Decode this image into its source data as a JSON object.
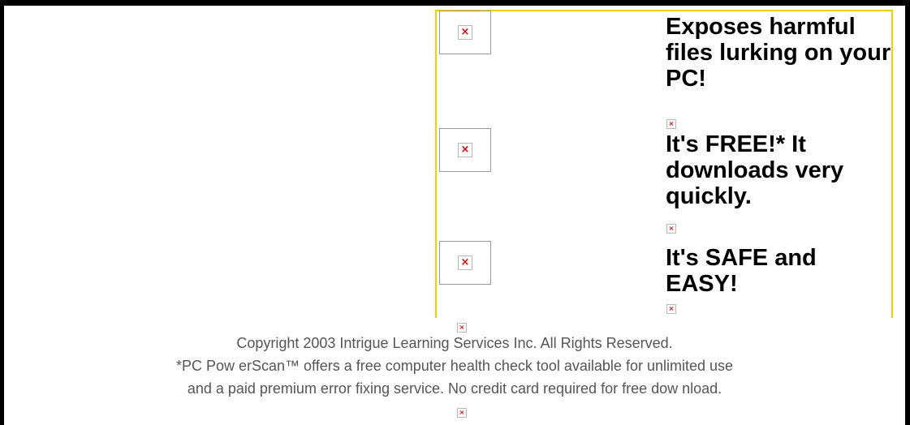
{
  "features": [
    {
      "text": "Exposes harmful files lurking on your PC!",
      "icon": "broken-image-icon"
    },
    {
      "text": "It's FREE!* It downloads very quickly.",
      "icon": "broken-image-icon"
    },
    {
      "text": "It's SAFE and EASY!",
      "icon": "broken-image-icon"
    }
  ],
  "footer": {
    "copyright": "Copyright 2003 Intrigue Learning Services Inc. All Rights Reserved.",
    "disclaimer_line1": "*PC Pow erScan™ offers a free computer health check tool available for unlimited use",
    "disclaimer_line2": "and a paid premium error fixing service. No credit card required for free dow nload."
  },
  "colors": {
    "promo_border": "#f0d000",
    "broken_x": "#e00000",
    "footer_text": "#555555",
    "frame": "#000000"
  }
}
